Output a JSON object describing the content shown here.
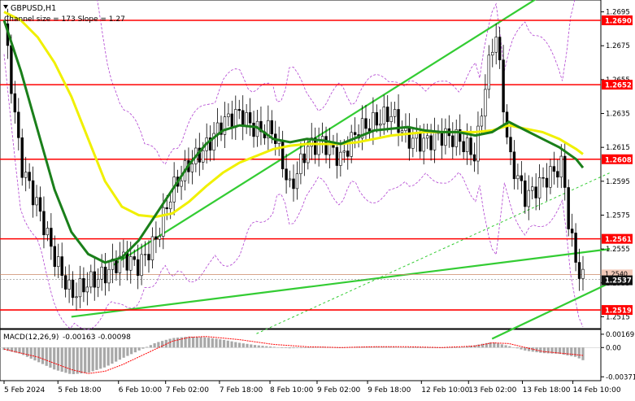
{
  "chart_data": [
    {
      "type": "candlestick",
      "title": "GBPUSD,H1",
      "indicator_label": "Channel size = 173 Slope = 1.27",
      "ylim": [
        1.2508,
        1.2702
      ],
      "y_ticks": [
        "1.2695",
        "1.2675",
        "1.2655",
        "1.2635",
        "1.2615",
        "1.2595",
        "1.2575",
        "1.2555",
        "1.2535",
        "1.2515"
      ],
      "horizontal_levels": [
        {
          "label": "1.2690",
          "value": 1.269
        },
        {
          "label": "1.2652",
          "value": 1.2652
        },
        {
          "label": "1.2608",
          "value": 1.2608
        },
        {
          "label": "1.2561",
          "value": 1.2561
        },
        {
          "label": "1.2519",
          "value": 1.2519
        }
      ],
      "current_price": {
        "label": "1.2537",
        "value": 1.2537,
        "prev_label": "1.2540",
        "prev_value": 1.254
      },
      "colors": {
        "level": "#ff0000",
        "channel": "#33cc33",
        "sma_fast": "#1a7f1a",
        "sma_slow": "#f0f000",
        "bands": "#b040d0",
        "candles": "#000000",
        "price_line": "#cc8866"
      },
      "price_path": [
        [
          0,
          1.2688
        ],
        [
          0.5,
          1.2605
        ],
        [
          1,
          1.258
        ],
        [
          1.5,
          1.255
        ],
        [
          2,
          1.2528
        ],
        [
          2.5,
          1.2535
        ],
        [
          3,
          1.254
        ],
        [
          3.5,
          1.255
        ],
        [
          4,
          1.2545
        ],
        [
          4.5,
          1.256
        ],
        [
          5,
          1.259
        ],
        [
          5.5,
          1.2605
        ],
        [
          6,
          1.2615
        ],
        [
          6.5,
          1.263
        ],
        [
          7,
          1.2635
        ],
        [
          7.5,
          1.2625
        ],
        [
          8,
          1.2625
        ],
        [
          8.5,
          1.259
        ],
        [
          9,
          1.2615
        ],
        [
          9.5,
          1.2618
        ],
        [
          10,
          1.2608
        ],
        [
          10.5,
          1.2625
        ],
        [
          11,
          1.263
        ],
        [
          11.5,
          1.2635
        ],
        [
          12,
          1.262
        ],
        [
          12.5,
          1.2618
        ],
        [
          13,
          1.2622
        ],
        [
          13.5,
          1.262
        ],
        [
          14,
          1.261
        ],
        [
          14.3,
          1.2652
        ],
        [
          14.6,
          1.2685
        ],
        [
          15,
          1.261
        ],
        [
          15.5,
          1.2585
        ],
        [
          16,
          1.2595
        ],
        [
          16.6,
          1.2605
        ],
        [
          16.8,
          1.2565
        ],
        [
          17.1,
          1.254
        ],
        [
          17.2,
          1.2537
        ]
      ],
      "sma_fast": [
        [
          0,
          1.269
        ],
        [
          0.5,
          1.266
        ],
        [
          1,
          1.2625
        ],
        [
          1.5,
          1.259
        ],
        [
          2,
          1.2565
        ],
        [
          2.5,
          1.2552
        ],
        [
          3,
          1.2547
        ],
        [
          3.5,
          1.255
        ],
        [
          4,
          1.256
        ],
        [
          4.5,
          1.2575
        ],
        [
          5,
          1.259
        ],
        [
          5.5,
          1.2605
        ],
        [
          6,
          1.2617
        ],
        [
          6.5,
          1.2625
        ],
        [
          7,
          1.2628
        ],
        [
          7.5,
          1.2627
        ],
        [
          8,
          1.262
        ],
        [
          8.5,
          1.2618
        ],
        [
          9,
          1.262
        ],
        [
          9.5,
          1.2619
        ],
        [
          10,
          1.2617
        ],
        [
          10.5,
          1.2621
        ],
        [
          11,
          1.2625
        ],
        [
          11.5,
          1.2626
        ],
        [
          12,
          1.2627
        ],
        [
          12.5,
          1.2625
        ],
        [
          13,
          1.2624
        ],
        [
          13.5,
          1.2624
        ],
        [
          14,
          1.2622
        ],
        [
          14.5,
          1.2624
        ],
        [
          15,
          1.263
        ],
        [
          15.5,
          1.2625
        ],
        [
          16,
          1.262
        ],
        [
          16.5,
          1.2615
        ],
        [
          17,
          1.2608
        ],
        [
          17.2,
          1.2603
        ]
      ],
      "sma_slow": [
        [
          0,
          1.2695
        ],
        [
          0.5,
          1.269
        ],
        [
          1,
          1.268
        ],
        [
          1.5,
          1.2665
        ],
        [
          2,
          1.2645
        ],
        [
          2.5,
          1.262
        ],
        [
          3,
          1.2595
        ],
        [
          3.5,
          1.258
        ],
        [
          4,
          1.2575
        ],
        [
          4.5,
          1.2574
        ],
        [
          5,
          1.2576
        ],
        [
          5.5,
          1.2583
        ],
        [
          6,
          1.2592
        ],
        [
          6.5,
          1.26
        ],
        [
          7,
          1.2606
        ],
        [
          7.5,
          1.261
        ],
        [
          8,
          1.2614
        ],
        [
          8.5,
          1.2616
        ],
        [
          9,
          1.2617
        ],
        [
          9.5,
          1.2617
        ],
        [
          10,
          1.2617
        ],
        [
          10.5,
          1.2618
        ],
        [
          11,
          1.262
        ],
        [
          11.5,
          1.2622
        ],
        [
          12,
          1.2623
        ],
        [
          12.5,
          1.2624
        ],
        [
          13,
          1.2624
        ],
        [
          13.5,
          1.2624
        ],
        [
          14,
          1.2624
        ],
        [
          14.5,
          1.2625
        ],
        [
          15,
          1.2628
        ],
        [
          15.5,
          1.2626
        ],
        [
          16,
          1.2624
        ],
        [
          16.5,
          1.262
        ],
        [
          17,
          1.2614
        ],
        [
          17.2,
          1.2611
        ]
      ],
      "channel_lower": [
        [
          2,
          1.2515
        ],
        [
          18,
          1.2555
        ]
      ],
      "channel_upper": [
        [
          3.2,
          1.2545
        ],
        [
          16,
          1.2705
        ]
      ],
      "channel_mid": [
        [
          7.5,
          1.2505
        ],
        [
          18,
          1.26
        ]
      ],
      "channel_bottom": [
        [
          14.5,
          1.2502
        ],
        [
          18,
          1.2535
        ]
      ],
      "x_labels": [
        "5 Feb 2024",
        "5 Feb 18:00",
        "6 Feb 10:00",
        "7 Feb 02:00",
        "7 Feb 18:00",
        "8 Feb 10:00",
        "9 Feb 02:00",
        "9 Feb 18:00",
        "12 Feb 10:00",
        "13 Feb 02:00",
        "13 Feb 18:00",
        "14 Feb 10:00"
      ],
      "x_label_slots": [
        0,
        1.6,
        3.4,
        4.8,
        6.4,
        7.9,
        9.3,
        10.8,
        12.4,
        13.8,
        15.4,
        16.9
      ]
    },
    {
      "type": "histogram",
      "title": "MACD(12,26,9)",
      "values_label": "-0.00163 -0.00098",
      "ylim": [
        -0.0042,
        0.0023
      ],
      "y_ticks": [
        "0.00169",
        "0.00",
        "-0.00371"
      ],
      "histogram": [
        [
          0,
          -0.0003
        ],
        [
          0.5,
          -0.0008
        ],
        [
          1,
          -0.0018
        ],
        [
          1.5,
          -0.0028
        ],
        [
          2,
          -0.0034
        ],
        [
          2.5,
          -0.0032
        ],
        [
          3,
          -0.0025
        ],
        [
          3.5,
          -0.0014
        ],
        [
          4,
          -0.0004
        ],
        [
          4.5,
          0.0006
        ],
        [
          5,
          0.0012
        ],
        [
          5.5,
          0.0014
        ],
        [
          6,
          0.0013
        ],
        [
          6.5,
          0.001
        ],
        [
          7,
          0.0006
        ],
        [
          7.5,
          0.0003
        ],
        [
          8,
          0.0001
        ],
        [
          8.5,
          -0.0001
        ],
        [
          9,
          0.0
        ],
        [
          9.5,
          0.0001
        ],
        [
          10,
          0.0
        ],
        [
          10.5,
          0.0001
        ],
        [
          11,
          0.0001
        ],
        [
          11.5,
          0.0001
        ],
        [
          12,
          0.0
        ],
        [
          12.5,
          0.0
        ],
        [
          13,
          0.0
        ],
        [
          13.5,
          0.0
        ],
        [
          14,
          0.0003
        ],
        [
          14.5,
          0.0007
        ],
        [
          15,
          0.0002
        ],
        [
          15.5,
          -0.0004
        ],
        [
          16,
          -0.0007
        ],
        [
          16.5,
          -0.0008
        ],
        [
          17,
          -0.0012
        ],
        [
          17.2,
          -0.0016
        ]
      ],
      "signal": [
        [
          0,
          -0.0002
        ],
        [
          1,
          -0.0012
        ],
        [
          2,
          -0.0028
        ],
        [
          2.5,
          -0.0033
        ],
        [
          3,
          -0.003
        ],
        [
          3.5,
          -0.0022
        ],
        [
          4,
          -0.0012
        ],
        [
          4.5,
          -0.0002
        ],
        [
          5,
          0.0008
        ],
        [
          5.5,
          0.0013
        ],
        [
          6,
          0.0014
        ],
        [
          7,
          0.001
        ],
        [
          8,
          0.0004
        ],
        [
          9,
          0.0001
        ],
        [
          10,
          0.0
        ],
        [
          11,
          0.0001
        ],
        [
          12,
          0.0001
        ],
        [
          13,
          0.0
        ],
        [
          14,
          0.0002
        ],
        [
          14.5,
          0.0006
        ],
        [
          15,
          0.0005
        ],
        [
          15.5,
          0.0
        ],
        [
          16,
          -0.0005
        ],
        [
          17,
          -0.0009
        ],
        [
          17.2,
          -0.001
        ]
      ],
      "colors": {
        "histogram": "#a8a8a8",
        "signal": "#ff0000"
      }
    }
  ]
}
